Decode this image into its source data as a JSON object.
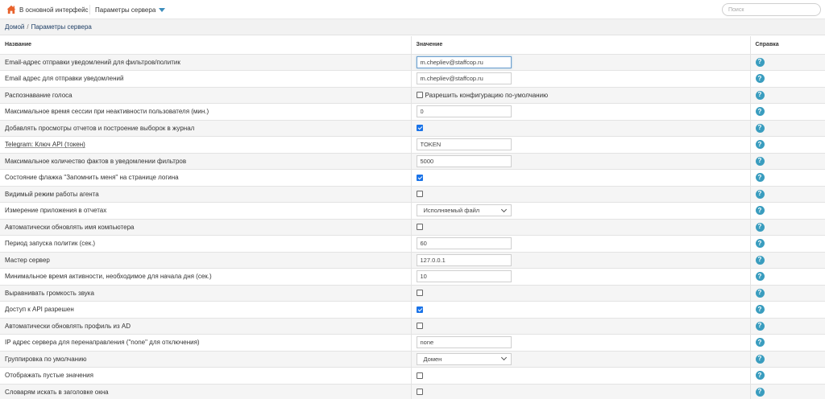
{
  "topbar": {
    "home_label": "В основной интерфейс",
    "menu_label": "Параметры сервера",
    "search_placeholder": "Поиск"
  },
  "breadcrumb": {
    "home": "Домой",
    "divider": "/",
    "current": "Параметры сервера"
  },
  "table": {
    "headers": {
      "name": "Название",
      "value": "Значение",
      "help": "Справка"
    },
    "rows": [
      {
        "name": "Email-адрес отправки уведомлений для фильтров/политик",
        "type": "text",
        "value": "m.chepliev@staffcop.ru"
      },
      {
        "name": "Email адрес для отправки уведомлений",
        "type": "text",
        "value": "m.chepliev@staffcop.ru"
      },
      {
        "name": "Распознавание голоса",
        "type": "checkbox",
        "checked": false,
        "label": "Разрешить конфигурацию по-умолчанию"
      },
      {
        "name": "Максимальное время сессии при неактивности пользователя (мин.)",
        "type": "text",
        "value": "0"
      },
      {
        "name": "Добавлять просмотры отчетов и построение выборок в журнал",
        "type": "checkbox",
        "checked": true
      },
      {
        "name": "Telegram: Ключ API (токен)",
        "type": "text",
        "value": "TOKEN"
      },
      {
        "name": "Максимальное количество фактов в уведомлении фильтров",
        "type": "text",
        "value": "5000"
      },
      {
        "name": "Состояние флажка \"Запомнить меня\" на странице логина",
        "type": "checkbox",
        "checked": true
      },
      {
        "name": "Видимый режим работы агента",
        "type": "checkbox",
        "checked": false
      },
      {
        "name": "Измерение приложения в отчетах",
        "type": "select",
        "value": "Исполняемый файл"
      },
      {
        "name": "Автоматически обновлять имя компьютера",
        "type": "checkbox",
        "checked": false
      },
      {
        "name": "Период запуска политик (сек.)",
        "type": "text",
        "value": "60"
      },
      {
        "name": "Мастер сервер",
        "type": "text",
        "value": "127.0.0.1"
      },
      {
        "name": "Минимальное время активности, необходимое для начала дня (сек.)",
        "type": "text",
        "value": "10"
      },
      {
        "name": "Выравнивать громкость звука",
        "type": "checkbox",
        "checked": false
      },
      {
        "name": "Доступ к API разрешен",
        "type": "checkbox",
        "checked": true
      },
      {
        "name": "Автоматически обновлять профиль из AD",
        "type": "checkbox",
        "checked": false
      },
      {
        "name": "IP адрес сервера для перенаправления (\"none\" для отключения)",
        "type": "text",
        "value": "none"
      },
      {
        "name": "Группировка по умолчанию",
        "type": "select",
        "value": "Домен"
      },
      {
        "name": "Отображать пустые значения",
        "type": "checkbox",
        "checked": false
      },
      {
        "name": "Словарям искать в заголовке окна",
        "type": "checkbox",
        "checked": false
      }
    ]
  },
  "colors": {
    "accent": "#3c8dbc",
    "help_icon": "#3a9dbf",
    "checkbox_checked": "#1a73e8",
    "home_icon": "#e8622c"
  }
}
